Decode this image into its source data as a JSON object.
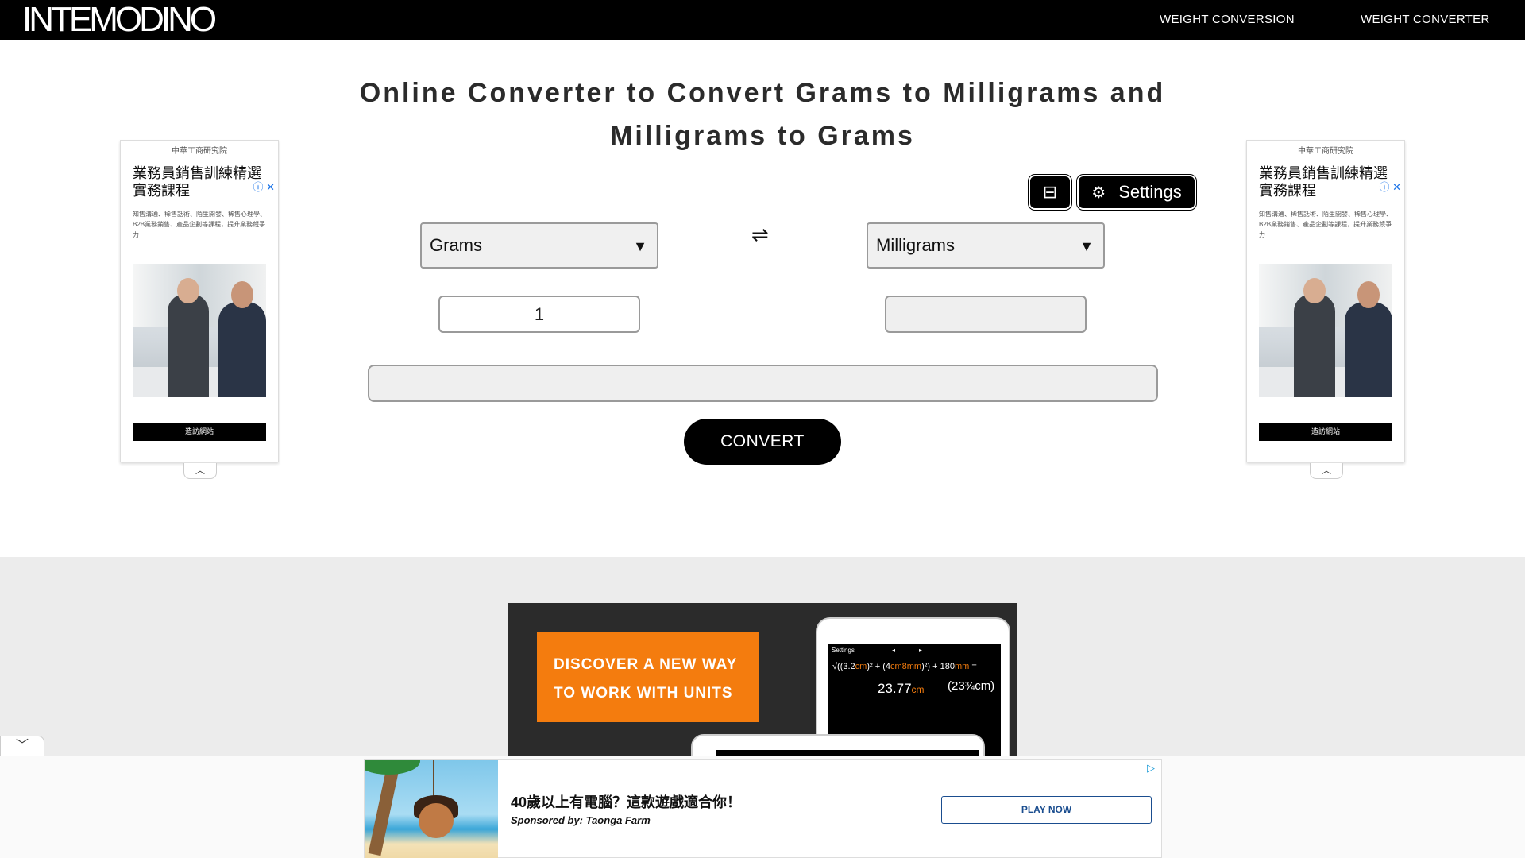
{
  "header": {
    "logo": "INTEMODINO",
    "nav": [
      "WEIGHT CONVERSION",
      "WEIGHT CONVERTER"
    ]
  },
  "title": "Online Converter to Convert Grams to Milligrams and Milligrams to Grams",
  "toolbar": {
    "collapse_icon": "⊟",
    "settings_icon": "⚙",
    "settings_label": "Settings"
  },
  "converter": {
    "from_unit": "Grams",
    "to_unit": "Milligrams",
    "select_arrow": "▼",
    "swap_icon": "⇌",
    "from_value": "1",
    "to_value": "",
    "formula": "",
    "convert_label": "CONVERT"
  },
  "side_ad": {
    "org": "中華工商研究院",
    "headline": "業務員銷售訓練精選實務課程",
    "description": "知售溝通、稀售話術、陌生開發、稀售心理學、B2B業務銷售、產品企劃等課程，提升業務競爭力",
    "cta": "造訪網站",
    "ad_choice": "ⓘ ✕",
    "collapse_icon": "︿"
  },
  "banner": {
    "line1": "DISCOVER A NEW WAY",
    "line2": "TO WORK WITH UNITS",
    "screen_settings": "Settings",
    "screen_formula_1": "√((3.2",
    "screen_unit_cm": "cm",
    "screen_formula_2": ")² + (4",
    "screen_unit_cm8mm": "cm8mm",
    "screen_formula_3": ")²) + 180",
    "screen_unit_mm": "mm",
    "screen_formula_4": " =",
    "screen_result": "23.77",
    "screen_fraction": "(23¾cm)"
  },
  "bottom_collapse_icon": "﹀",
  "sticky_ad": {
    "title": "40歲以上有電腦？這款遊戲適合你！",
    "sponsor": "Sponsored by: Taonga Farm",
    "button": "PLAY NOW",
    "ad_choice": "▷"
  }
}
